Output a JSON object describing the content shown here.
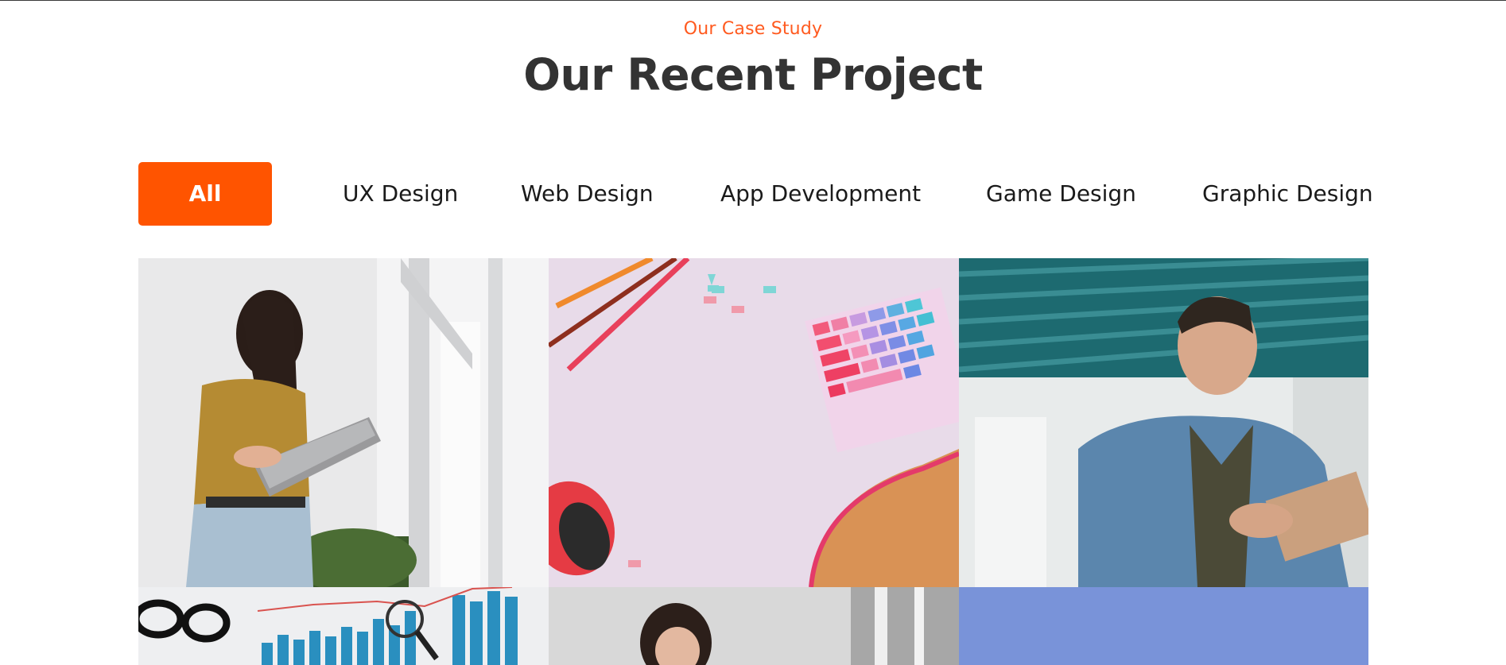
{
  "section": {
    "eyebrow": "Our Case Study",
    "title": "Our Recent Project"
  },
  "filters": [
    {
      "label": "All",
      "active": true
    },
    {
      "label": "UX Design",
      "active": false
    },
    {
      "label": "Web Design",
      "active": false
    },
    {
      "label": "App Development",
      "active": false
    },
    {
      "label": "Game Design",
      "active": false
    },
    {
      "label": "Graphic Design",
      "active": false
    }
  ],
  "colors": {
    "accent": "#ff5400",
    "eyebrow": "#ff5a1f",
    "title": "#333333"
  },
  "projects": [
    {
      "photo": "woman-with-tablet-photo"
    },
    {
      "photo": "desk-keyboard-mouse-photo"
    },
    {
      "photo": "man-with-tablet-photo"
    },
    {
      "photo": "analytics-chart-photo"
    },
    {
      "photo": "smiling-woman-photo"
    },
    {
      "photo": "blue-background-photo"
    }
  ]
}
